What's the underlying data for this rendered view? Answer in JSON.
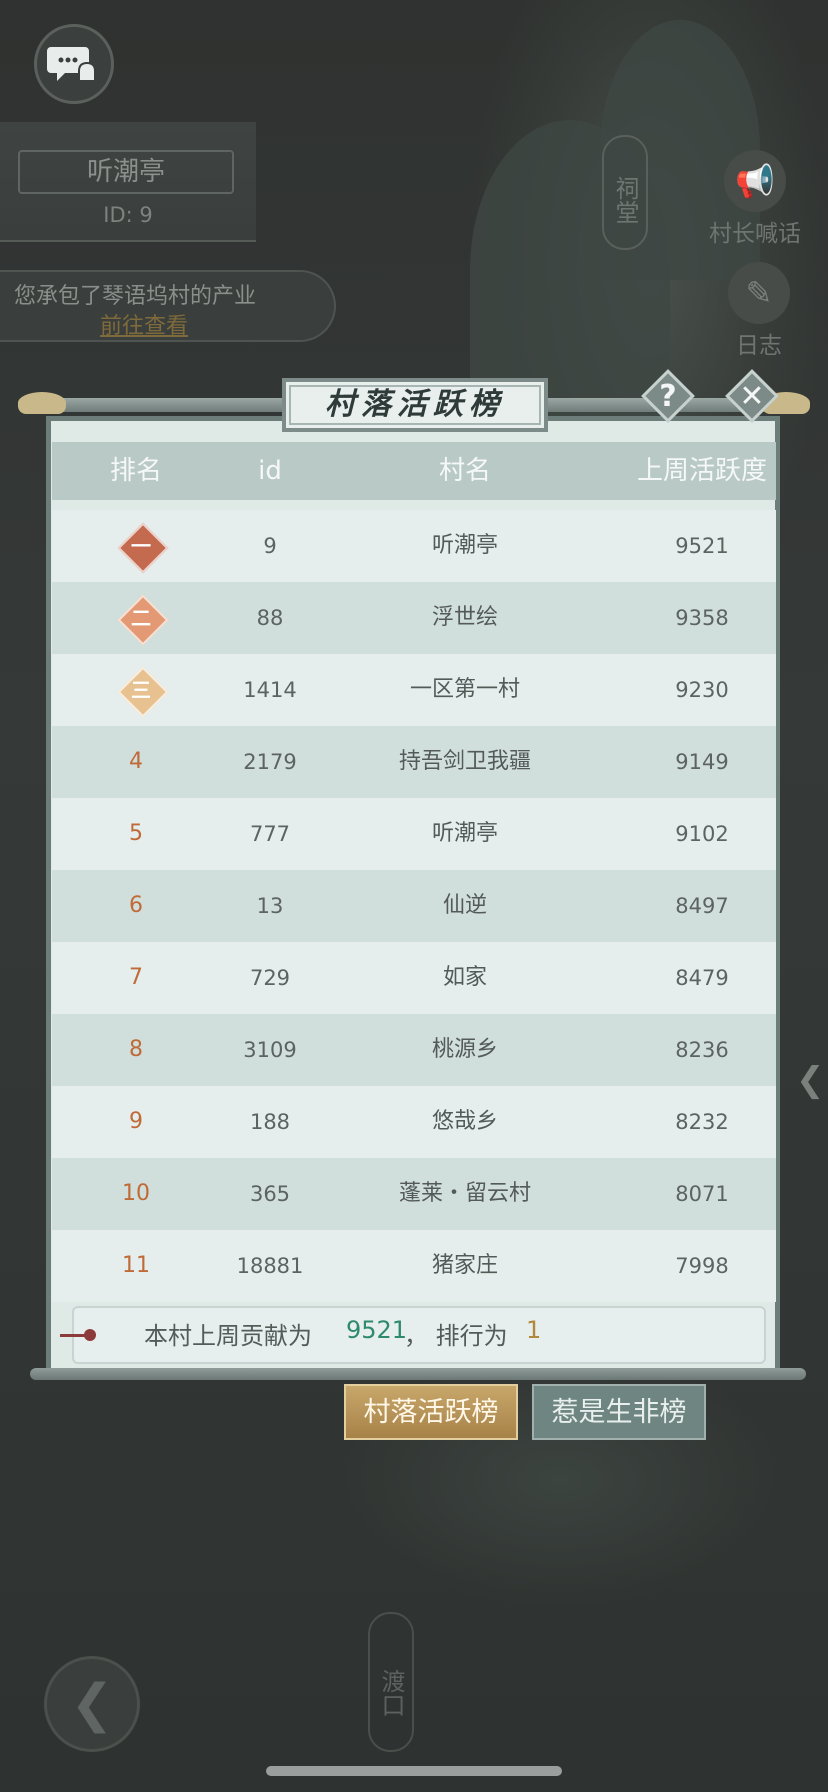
{
  "hud": {
    "village_name": "听潮亭",
    "village_id": "ID: 9",
    "notice_text": "您承包了琴语坞村的产业",
    "notice_link": "前往查看",
    "ancestral_hall": "祠堂",
    "chief_shout": "村长喊话",
    "log": "日志",
    "ferry": "渡口"
  },
  "panel": {
    "title": "村落活跃榜",
    "help_label": "?",
    "close_label": "✕",
    "headers": [
      "排名",
      "id",
      "村名",
      "上周活跃度"
    ],
    "rows": [
      {
        "rank": "一",
        "id": "9",
        "name": "听潮亭",
        "activity": "9521"
      },
      {
        "rank": "二",
        "id": "88",
        "name": "浮世绘",
        "activity": "9358"
      },
      {
        "rank": "三",
        "id": "1414",
        "name": "一区第一村",
        "activity": "9230"
      },
      {
        "rank": "4",
        "id": "2179",
        "name": "持吾剑卫我疆",
        "activity": "9149"
      },
      {
        "rank": "5",
        "id": "777",
        "name": "听潮亭",
        "activity": "9102"
      },
      {
        "rank": "6",
        "id": "13",
        "name": "仙逆",
        "activity": "8497"
      },
      {
        "rank": "7",
        "id": "729",
        "name": "如家",
        "activity": "8479"
      },
      {
        "rank": "8",
        "id": "3109",
        "name": "桃源乡",
        "activity": "8236"
      },
      {
        "rank": "9",
        "id": "188",
        "name": "悠哉乡",
        "activity": "8232"
      },
      {
        "rank": "10",
        "id": "365",
        "name": "蓬莱・留云村",
        "activity": "8071"
      },
      {
        "rank": "11",
        "id": "18881",
        "name": "猪家庄",
        "activity": "7998"
      }
    ],
    "summary": {
      "prefix": "本村上周贡献为",
      "contribution": "9521",
      "middle": "，  排行为",
      "rank": "1"
    }
  },
  "tabs": {
    "active": "村落活跃榜",
    "inactive": "惹是生非榜"
  },
  "colors": {
    "rank_text": "#c06a38",
    "contribution_value": "#2e8a6a",
    "rank_value": "#b08a3a",
    "active_tab": "#b8955a",
    "inactive_tab": "#6f8582"
  }
}
